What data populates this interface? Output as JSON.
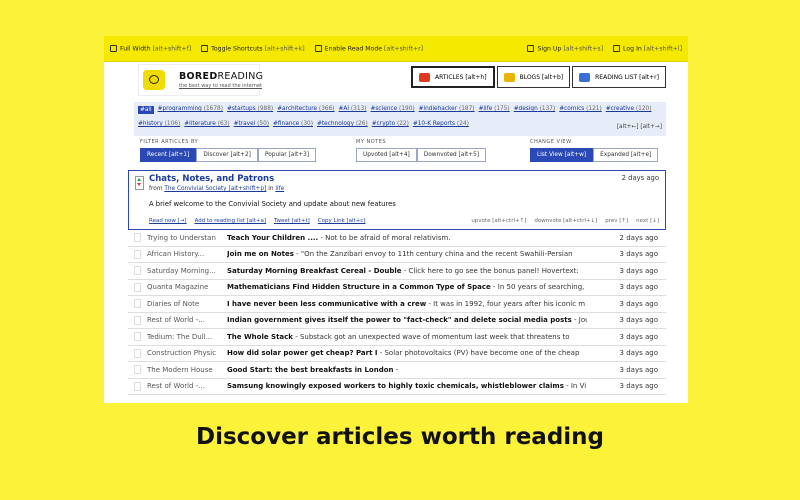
{
  "topbar": {
    "left": [
      {
        "icon": "full-width-icon",
        "label": "Full Width",
        "key": "[alt+shift+f]"
      },
      {
        "icon": "keyboard-icon",
        "label": "Toggle Shortcuts",
        "key": "[alt+shift+k]"
      },
      {
        "icon": "read-mode-icon",
        "label": "Enable Read Mode",
        "key": "[alt+shift+r]"
      }
    ],
    "right": [
      {
        "icon": "user-icon",
        "label": "Sign Up",
        "key": "[alt+shift+s]"
      },
      {
        "icon": "login-icon",
        "label": "Log In",
        "key": "[alt+shift+l]"
      }
    ]
  },
  "brand": {
    "name_bold": "BORED",
    "name_rest": "READING",
    "tagline": "the best way to read the internet"
  },
  "nav": [
    {
      "label": "ARTICLES [alt+h]",
      "icon": "articles-icon",
      "color": "#e03a1e"
    },
    {
      "label": "BLOGS [alt+b]",
      "icon": "blogs-icon",
      "color": "#e8b400"
    },
    {
      "label": "READING LIST [alt+r]",
      "icon": "reading-list-icon",
      "color": "#3a6fd8"
    }
  ],
  "tags_row1": [
    {
      "name": "#all",
      "count": ""
    },
    {
      "name": "#programming",
      "count": "(1678)"
    },
    {
      "name": "#startups",
      "count": "(988)"
    },
    {
      "name": "#architecture",
      "count": "(366)"
    },
    {
      "name": "#AI",
      "count": "(313)"
    },
    {
      "name": "#science",
      "count": "(190)"
    },
    {
      "name": "#indiehacker",
      "count": "(187)"
    },
    {
      "name": "#life",
      "count": "(175)"
    },
    {
      "name": "#design",
      "count": "(137)"
    },
    {
      "name": "#comics",
      "count": "(121)"
    },
    {
      "name": "#creative",
      "count": "(120)"
    }
  ],
  "tags_row2": [
    {
      "name": "#history",
      "count": "(106)"
    },
    {
      "name": "#literature",
      "count": "(63)"
    },
    {
      "name": "#travel",
      "count": "(50)"
    },
    {
      "name": "#finance",
      "count": "(30)"
    },
    {
      "name": "#technology",
      "count": "(26)"
    },
    {
      "name": "#crypto",
      "count": "(22)"
    },
    {
      "name": "#10-K Reports",
      "count": "(24)"
    }
  ],
  "tags_hint": "[alt+←] [alt+→]",
  "filters": {
    "filter_label": "FILTER ARTICLES BY",
    "filter_btns": [
      "Recent [alt+1]",
      "Discover [alt+2]",
      "Popular [alt+3]"
    ],
    "notes_label": "MY NOTES",
    "notes_btns": [
      "Upvoted [alt+4]",
      "Downvoted [alt+5]"
    ],
    "view_label": "CHANGE VIEW",
    "view_btns": [
      "List View [alt+w]",
      "Expanded [alt+e]"
    ]
  },
  "featured": {
    "title": "Chats, Notes, and Patrons",
    "from_prefix": "from",
    "source": "The Convivial Society [alt+shift+p]",
    "in_text": "in",
    "tag": "life",
    "date": "2 days ago",
    "desc": "A brief welcome to the Convivial Society and update about new features",
    "actions": [
      "Read now [→]",
      "Add to reading list [alt+a]",
      "Tweet [alt+t]",
      "Copy Link [alt+c]"
    ],
    "right_actions": [
      "upvote [alt+ctrl+↑]",
      "downvote [alt+ctrl+↓]",
      "prev [↑]",
      "next [↓]"
    ]
  },
  "articles": [
    {
      "src": "Trying to Understan",
      "title": "Teach Your Children ....",
      "rest": " - Not to be afraid of moral relativism.",
      "date": "2 days ago"
    },
    {
      "src": "African History...",
      "title": "Join me on Notes",
      "rest": " - \"On the Zanzibari envoy to 11th century china and the recent Swahili-Persian",
      "date": "3 days ago"
    },
    {
      "src": "Saturday Morning...",
      "title": "Saturday Morning Breakfast Cereal - Double",
      "rest": " - Click here to go see the bonus panel! Hovertext:",
      "date": "3 days ago"
    },
    {
      "src": "Quanta Magazine",
      "title": "Mathematicians Find Hidden Structure in a Common Type of Space",
      "rest": " - In 50 years of searching,",
      "date": "3 days ago"
    },
    {
      "src": "Diaries of Note",
      "title": "I have never been less communicative with a crew",
      "rest": " - It was in 1992, four years after his iconic m",
      "date": "3 days ago"
    },
    {
      "src": "Rest of World -...",
      "title": "Indian government gives itself the power to \"fact-check\" and delete social media posts",
      "rest": " - Jou",
      "date": "3 days ago"
    },
    {
      "src": "Tedium: The Dull...",
      "title": "The Whole Stack",
      "rest": " - Substack got an unexpected wave of momentum last week that threatens to",
      "date": "3 days ago"
    },
    {
      "src": "Construction Physic",
      "title": "How did solar power get cheap? Part I",
      "rest": " - Solar photovoltaics (PV) have become one of the cheap",
      "date": "3 days ago"
    },
    {
      "src": "The Modern House",
      "title": "Good Start: the best breakfasts in London",
      "rest": " - ",
      "date": "3 days ago"
    },
    {
      "src": "Rest of World -...",
      "title": "Samsung knowingly exposed workers to highly toxic chemicals, whistleblower claims",
      "rest": " - In Vi",
      "date": "3 days ago"
    }
  ],
  "caption": "Discover articles worth reading"
}
